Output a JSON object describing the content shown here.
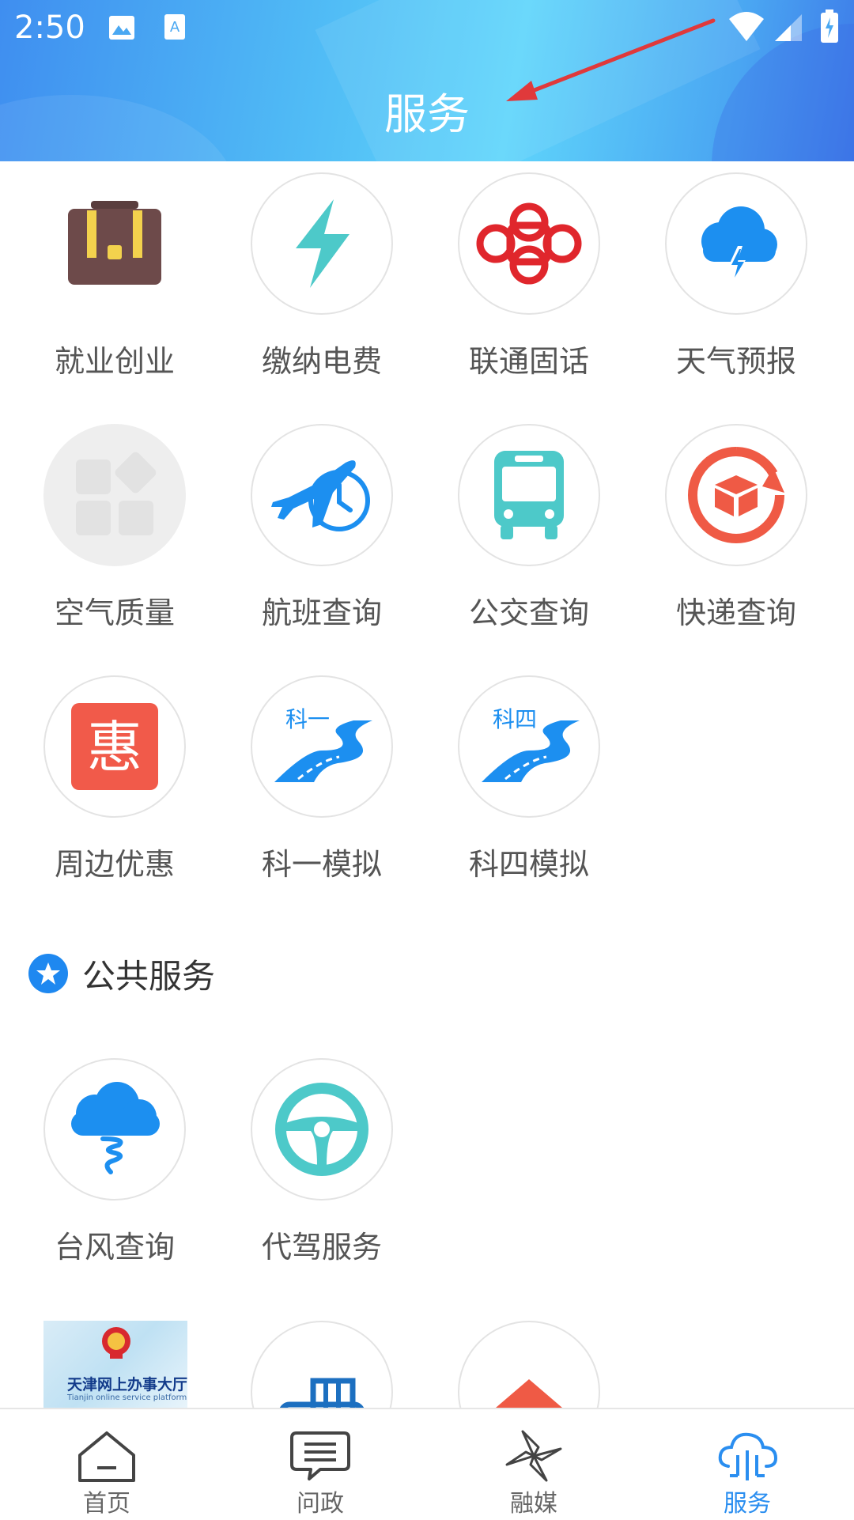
{
  "status_bar": {
    "time": "2:50"
  },
  "header": {
    "title": "服务"
  },
  "services": [
    {
      "label": "就业创业",
      "icon": "briefcase-icon"
    },
    {
      "label": "缴纳电费",
      "icon": "lightning-icon"
    },
    {
      "label": "联通固话",
      "icon": "unicom-knot-icon"
    },
    {
      "label": "天气预报",
      "icon": "thunder-cloud-icon"
    },
    {
      "label": "空气质量",
      "icon": "placeholder-grid-icon"
    },
    {
      "label": "航班查询",
      "icon": "airplane-clock-icon"
    },
    {
      "label": "公交查询",
      "icon": "bus-icon"
    },
    {
      "label": "快递查询",
      "icon": "parcel-cycle-icon"
    },
    {
      "label": "周边优惠",
      "icon": "discount-hui-icon"
    },
    {
      "label": "科一模拟",
      "icon": "road-icon",
      "badge": "科一"
    },
    {
      "label": "科四模拟",
      "icon": "road-icon",
      "badge": "科四"
    }
  ],
  "public_section": {
    "title": "公共服务"
  },
  "public_services": [
    {
      "label": "台风查询",
      "icon": "typhoon-cloud-icon"
    },
    {
      "label": "代驾服务",
      "icon": "steering-wheel-icon"
    }
  ],
  "more_services": [
    {
      "title": "天津网上办事大厅",
      "subtitle": "Tianjin online service platform",
      "icon": "gov-emblem-icon"
    },
    {
      "icon": "printer-icon"
    },
    {
      "icon": "house-icon"
    }
  ],
  "bottom_nav": [
    {
      "label": "首页",
      "icon": "home-icon"
    },
    {
      "label": "问政",
      "icon": "chat-bubble-icon"
    },
    {
      "label": "融媒",
      "icon": "pinwheel-icon"
    },
    {
      "label": "服务",
      "icon": "cloud-service-icon",
      "active": true
    }
  ],
  "colors": {
    "accent": "#2a8ef0",
    "header_start": "#3f8ef0",
    "header_end": "#3d79e8"
  }
}
